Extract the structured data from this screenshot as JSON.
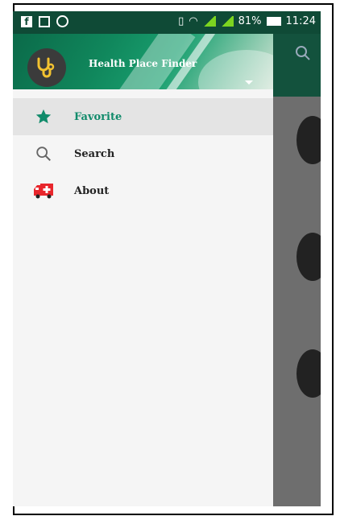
{
  "status_bar": {
    "battery": "81%",
    "time": "11:24"
  },
  "drawer": {
    "header_title": "Health Place Finder",
    "items": [
      {
        "label": "Favorite",
        "icon": "star-icon",
        "active": true
      },
      {
        "label": "Search",
        "icon": "search-icon",
        "active": false
      },
      {
        "label": "About",
        "icon": "ambulance-icon",
        "active": false
      }
    ]
  },
  "colors": {
    "primary_dark": "#0f4a36",
    "accent": "#118b6b",
    "ambulance_red": "#e8262c"
  }
}
